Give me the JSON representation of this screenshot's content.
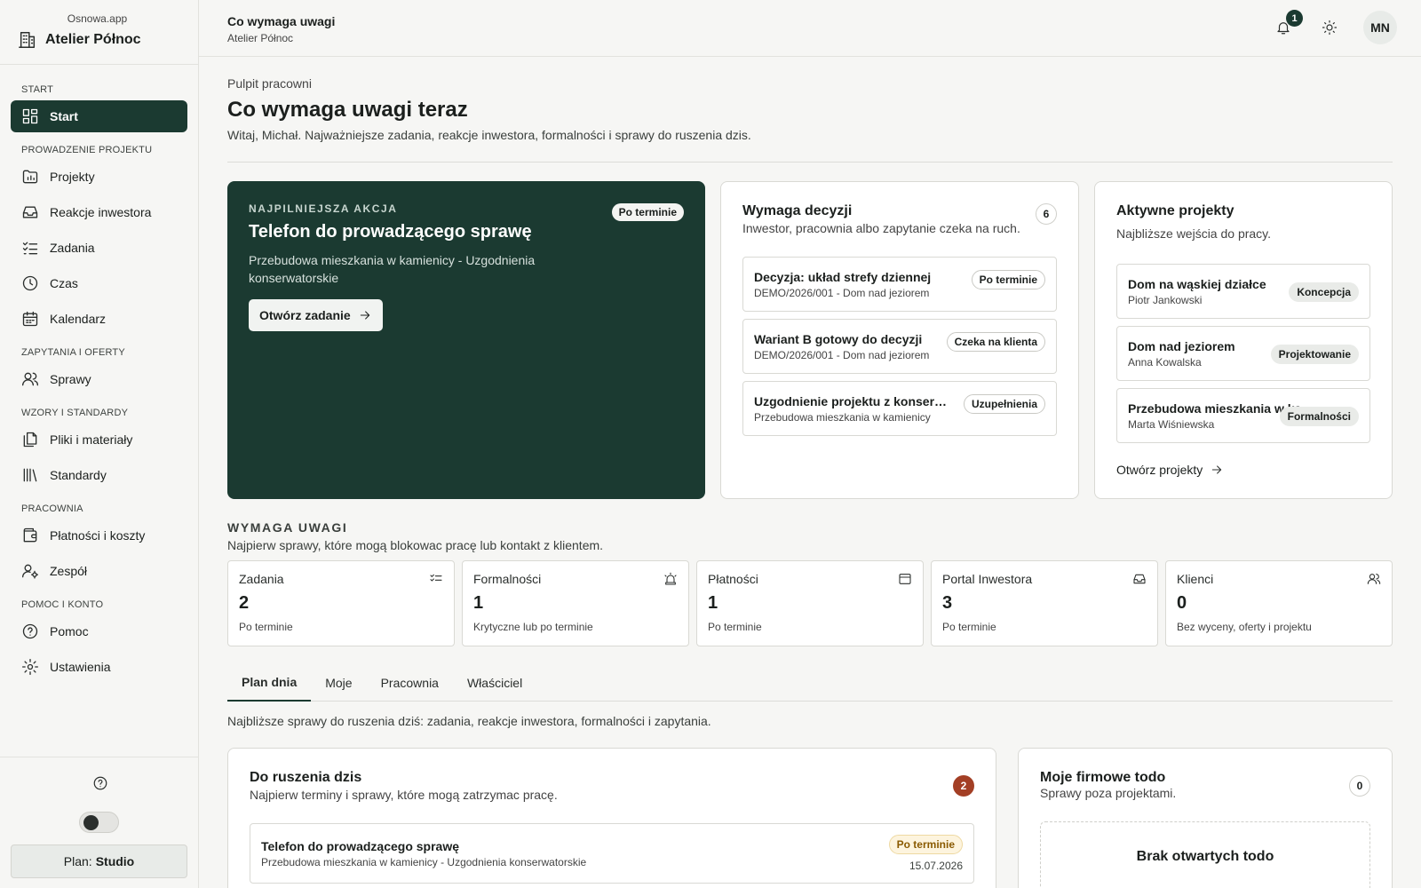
{
  "sidebar": {
    "app": "Osnowa.app",
    "workspace": "Atelier Północ",
    "sections": {
      "start": "START",
      "project": "PROWADZENIE PROJEKTU",
      "offers": "ZAPYTANIA I OFERTY",
      "standards": "WZORY I STANDARDY",
      "studio": "PRACOWNIA",
      "help": "POMOC I KONTO"
    },
    "items": {
      "start": "Start",
      "projects": "Projekty",
      "reactions": "Reakcje inwestora",
      "tasks": "Zadania",
      "time": "Czas",
      "calendar": "Kalendarz",
      "cases": "Sprawy",
      "files": "Pliki i materiały",
      "standards": "Standardy",
      "payments": "Płatności i koszty",
      "team": "Zespół",
      "help": "Pomoc",
      "settings": "Ustawienia"
    },
    "plan_label": "Plan:",
    "plan_value": "Studio"
  },
  "topbar": {
    "title": "Co wymaga uwagi",
    "subtitle": "Atelier Północ",
    "notifications": "1",
    "avatar": "MN"
  },
  "header": {
    "breadcrumb": "Pulpit pracowni",
    "title": "Co wymaga uwagi teraz",
    "lead": "Witaj, Michał. Najważniejsze zadania, reakcje inwestora, formalności i sprawy do ruszenia dzis."
  },
  "hero": {
    "kicker": "NAJPILNIEJSZA AKCJA",
    "tag": "Po terminie",
    "title": "Telefon do prowadzącego sprawę",
    "desc": "Przebudowa mieszkania w kamienicy - Uzgodnienia konserwatorskie",
    "button": "Otwórz zadanie"
  },
  "decisions": {
    "title": "Wymaga decyzji",
    "subtitle": "Inwestor, pracownia albo zapytanie czeka na ruch.",
    "count": "6",
    "rows": [
      {
        "title": "Decyzja: układ strefy dziennej",
        "sub": "DEMO/2026/001 - Dom nad jeziorem",
        "tag": "Po terminie"
      },
      {
        "title": "Wariant B gotowy do decyzji",
        "sub": "DEMO/2026/001 - Dom nad jeziorem",
        "tag": "Czeka na klienta"
      },
      {
        "title": "Uzgodnienie projektu z konserwatorem",
        "sub": "Przebudowa mieszkania w kamienicy",
        "tag": "Uzupełnienia"
      }
    ]
  },
  "projects": {
    "title": "Aktywne projekty",
    "subtitle": "Najbliższe wejścia do pracy.",
    "rows": [
      {
        "title": "Dom na wąskiej działce",
        "sub": "Piotr Jankowski",
        "tag": "Koncepcja"
      },
      {
        "title": "Dom nad jeziorem",
        "sub": "Anna Kowalska",
        "tag": "Projektowanie"
      },
      {
        "title": "Przebudowa mieszkania w kamienicy",
        "sub": "Marta Wiśniewska",
        "tag": "Formalności"
      }
    ],
    "link": "Otwórz projekty"
  },
  "attention": {
    "kicker": "WYMAGA UWAGI",
    "subtitle": "Najpierw sprawy, które mogą blokowac pracę lub kontakt z klientem.",
    "kpis": [
      {
        "label": "Zadania",
        "value": "2",
        "sub": "Po terminie"
      },
      {
        "label": "Formalności",
        "value": "1",
        "sub": "Krytyczne lub po terminie"
      },
      {
        "label": "Płatności",
        "value": "1",
        "sub": "Po terminie"
      },
      {
        "label": "Portal Inwestora",
        "value": "3",
        "sub": "Po terminie"
      },
      {
        "label": "Klienci",
        "value": "0",
        "sub": "Bez wyceny, oferty i projektu"
      }
    ]
  },
  "tabs": {
    "items": [
      "Plan dnia",
      "Moje",
      "Pracownia",
      "Właściciel"
    ],
    "note": "Najbliższe sprawy do ruszenia dziś: zadania, reakcje inwestora, formalności i zapytania."
  },
  "today": {
    "title": "Do ruszenia dzis",
    "subtitle": "Najpierw terminy i sprawy, które mogą zatrzymac pracę.",
    "count": "2",
    "row": {
      "title": "Telefon do prowadzącego sprawę",
      "sub": "Przebudowa mieszkania w kamienicy - Uzgodnienia konserwatorskie",
      "tag": "Po terminie",
      "date": "15.07.2026"
    }
  },
  "todo": {
    "title": "Moje firmowe todo",
    "subtitle": "Sprawy poza projektami.",
    "count": "0",
    "empty": "Brak otwartych todo"
  },
  "colors": {
    "primary": "#1b3a31",
    "accent_red": "#a33f25",
    "warn": "#fdf4de"
  }
}
